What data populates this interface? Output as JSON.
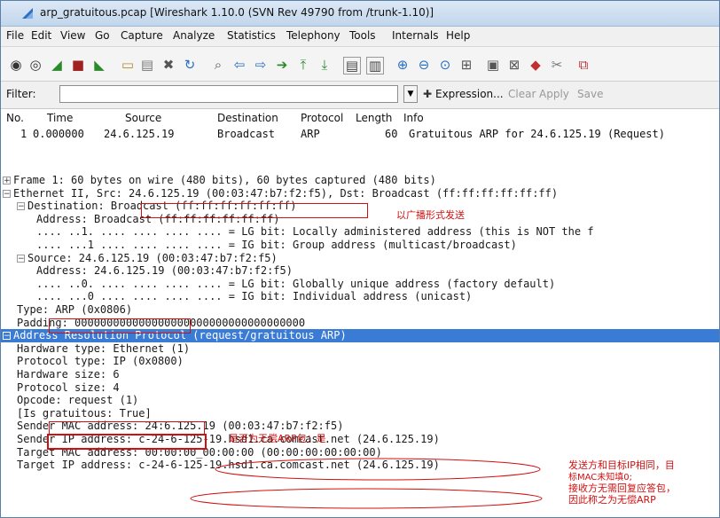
{
  "window": {
    "title": "arp_gratuitous.pcap  [Wireshark 1.10.0  (SVN Rev 49790 from /trunk-1.10)]"
  },
  "menu": [
    "File",
    "Edit",
    "View",
    "Go",
    "Capture",
    "Analyze",
    "Statistics",
    "Telephony",
    "Tools",
    "Internals",
    "Help"
  ],
  "toolbar_icons": [
    "start-capture-icon",
    "capture-options-icon",
    "shark-fin-icon",
    "stop-capture-icon",
    "restart-capture-icon",
    "open-file-icon",
    "save-file-icon",
    "close-file-icon",
    "reload-icon",
    "find-icon",
    "back-icon",
    "forward-icon",
    "go-to-packet-icon",
    "first-packet-icon",
    "last-packet-icon",
    "colorize-icon",
    "auto-scroll-icon",
    "zoom-in-icon",
    "zoom-out-icon",
    "zoom-normal-icon",
    "resize-columns-icon",
    "capture-filters-icon",
    "display-filters-icon",
    "coloring-rules-icon",
    "preferences-icon",
    "help-icon"
  ],
  "filter": {
    "label": "Filter:",
    "value": "",
    "expression": "Expression...",
    "clear": "Clear",
    "apply": "Apply",
    "save": "Save"
  },
  "packet_list": {
    "headers": [
      "No.",
      "Time",
      "Source",
      "Destination",
      "Protocol",
      "Length",
      "Info"
    ],
    "rows": [
      {
        "no": "1",
        "time": "0.000000",
        "source": "24.6.125.19",
        "destination": "Broadcast",
        "protocol": "ARP",
        "length": "60",
        "info": "Gratuitous ARP for 24.6.125.19 (Request)"
      }
    ]
  },
  "details": [
    {
      "indent": 0,
      "expander": "+",
      "text": "Frame 1: 60 bytes on wire (480 bits), 60 bytes captured (480 bits)"
    },
    {
      "indent": 0,
      "expander": "−",
      "text": "Ethernet II, Src: 24.6.125.19 (00:03:47:b7:f2:f5), Dst: Broadcast (ff:ff:ff:ff:ff:ff)"
    },
    {
      "indent": 1,
      "expander": "−",
      "text": "Destination: Broadcast (ff:ff:ff:ff:ff:ff)"
    },
    {
      "indent": 2,
      "expander": "",
      "text": "Address: Broadcast (ff:ff:ff:ff:ff:ff)"
    },
    {
      "indent": 2,
      "expander": "",
      "text": ".... ..1. .... .... .... .... = LG bit: Locally administered address (this is NOT the f"
    },
    {
      "indent": 2,
      "expander": "",
      "text": ".... ...1 .... .... .... .... = IG bit: Group address (multicast/broadcast)"
    },
    {
      "indent": 1,
      "expander": "−",
      "text": "Source: 24.6.125.19 (00:03:47:b7:f2:f5)"
    },
    {
      "indent": 2,
      "expander": "",
      "text": "Address: 24.6.125.19 (00:03:47:b7:f2:f5)"
    },
    {
      "indent": 2,
      "expander": "",
      "text": ".... ..0. .... .... .... .... = LG bit: Globally unique address (factory default)"
    },
    {
      "indent": 2,
      "expander": "",
      "text": ".... ...0 .... .... .... .... = IG bit: Individual address (unicast)"
    },
    {
      "indent": 1,
      "expander": "",
      "text": "Type: ARP (0x0806)"
    },
    {
      "indent": 1,
      "expander": "",
      "text": "Padding: 000000000000000000000000000000000000"
    },
    {
      "indent": 0,
      "expander": "−",
      "text": "Address Resolution Protocol (request/gratuitous ARP)",
      "selected": true
    },
    {
      "indent": 1,
      "expander": "",
      "text": "Hardware type: Ethernet (1)"
    },
    {
      "indent": 1,
      "expander": "",
      "text": "Protocol type: IP (0x0800)"
    },
    {
      "indent": 1,
      "expander": "",
      "text": "Hardware size: 6"
    },
    {
      "indent": 1,
      "expander": "",
      "text": "Protocol size: 4"
    },
    {
      "indent": 1,
      "expander": "",
      "text": "Opcode: request (1)"
    },
    {
      "indent": 1,
      "expander": "",
      "text": "[Is gratuitous: True]"
    },
    {
      "indent": 1,
      "expander": "",
      "text": "Sender MAC address: 24:6.125.19 (00:03:47:b7:f2:f5)"
    },
    {
      "indent": 1,
      "expander": "",
      "text": "Sender IP address: c-24-6-125-19.hsd1.ca.comcast.net (24.6.125.19)"
    },
    {
      "indent": 1,
      "expander": "",
      "text": "Target MAC address: 00:00:00_00:00:00 (00:00:00:00:00:00)"
    },
    {
      "indent": 1,
      "expander": "",
      "text": "Target IP address: c-24-6-125-19.hsd1.ca.comcast.net (24.6.125.19)"
    }
  ],
  "annotations": {
    "broadcast_note": "以广播形式发送",
    "gratuitous_note": "是否为无偿ARP包：是",
    "side_note_1": "发送方和目标IP相同，目",
    "side_note_2": "标MAC未知填0;",
    "side_note_3": "接收方无需回复应答包，",
    "side_note_4": "因此称之为无偿ARP"
  },
  "colors": {
    "selection": "#3a7bd5",
    "annotation": "#d01010"
  }
}
